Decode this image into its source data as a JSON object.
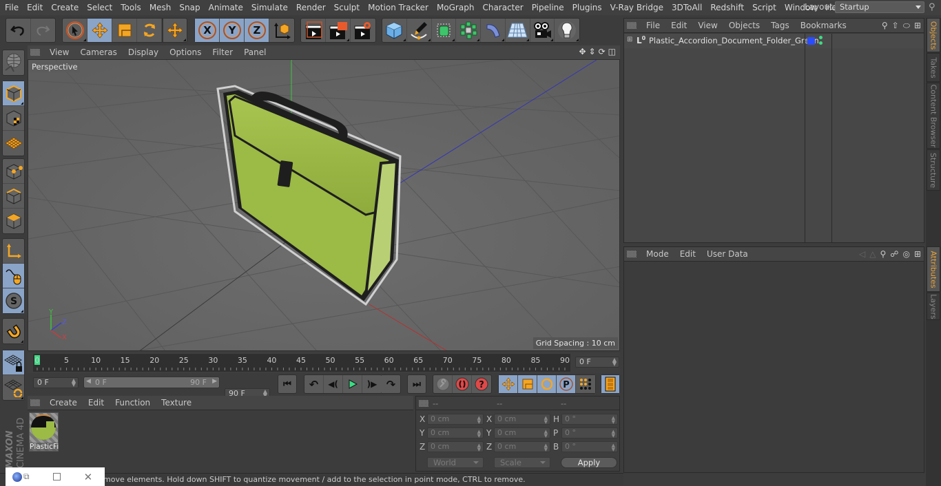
{
  "menubar": {
    "items": [
      "File",
      "Edit",
      "Create",
      "Select",
      "Tools",
      "Mesh",
      "Snap",
      "Animate",
      "Simulate",
      "Render",
      "Sculpt",
      "Motion Tracker",
      "MoGraph",
      "Character",
      "Pipeline",
      "Plugins",
      "V-Ray Bridge",
      "3DToAll",
      "Redshift",
      "Script",
      "Window",
      "Help"
    ],
    "layout_label": "Layout:",
    "layout_value": "Startup"
  },
  "toolbar": {
    "undo": "undo-icon",
    "redo": "redo-icon",
    "tools": [
      "select",
      "move",
      "scale",
      "rotate",
      "last-tool"
    ],
    "axes": [
      "X",
      "Y",
      "Z"
    ],
    "world_coords": "coordinate-system-icon",
    "render": [
      "render-view",
      "render-picture-viewer",
      "render-settings"
    ],
    "create": [
      "cube",
      "pen",
      "subdivision",
      "cloner",
      "deformer",
      "floor",
      "camera",
      "light"
    ]
  },
  "viewport": {
    "menu": [
      "View",
      "Cameras",
      "Display",
      "Options",
      "Filter",
      "Panel"
    ],
    "camera_label": "Perspective",
    "grid_spacing": "Grid Spacing : 10 cm",
    "object_color": "#9cba46",
    "axis_labels": [
      "Y",
      "Z",
      "X"
    ]
  },
  "timeline": {
    "ticks": [
      "0",
      "5",
      "10",
      "15",
      "20",
      "25",
      "30",
      "35",
      "40",
      "45",
      "50",
      "55",
      "60",
      "65",
      "70",
      "75",
      "80",
      "85",
      "90"
    ],
    "current_frame": "0 F",
    "start_frame": "0 F",
    "range_start": "0 F",
    "range_end": "90 F",
    "end_frame": "90 F",
    "playhead_color": "#3ddc84"
  },
  "material_manager": {
    "menu": [
      "Create",
      "Edit",
      "Function",
      "Texture"
    ],
    "materials": [
      {
        "name": "PlasticFi"
      }
    ]
  },
  "coordinates": {
    "headers": [
      "--",
      "--",
      "--"
    ],
    "position": {
      "X": "0 cm",
      "Y": "0 cm",
      "Z": "0 cm"
    },
    "size": {
      "X": "0 cm",
      "Y": "0 cm",
      "Z": "0 cm"
    },
    "rotation": {
      "H": "0 °",
      "P": "0 °",
      "B": "0 °"
    },
    "mode_dropdown": "World",
    "size_dropdown": "Scale",
    "apply_label": "Apply"
  },
  "status": {
    "text": "move elements. Hold down SHIFT to quantize movement / add to the selection in point mode, CTRL to remove."
  },
  "objects_panel": {
    "menu": [
      "File",
      "Edit",
      "View",
      "Objects",
      "Tags",
      "Bookmarks"
    ],
    "objects": [
      {
        "name": "Plastic_Accordion_Document_Folder_Green",
        "layer_color": "#2a4cff"
      }
    ]
  },
  "attributes_panel": {
    "menu": [
      "Mode",
      "Edit",
      "User Data"
    ]
  },
  "right_tabs": {
    "top": [
      "Objects",
      "Takes",
      "Content Browser",
      "Structure"
    ],
    "bottom": [
      "Attributes",
      "Layers"
    ]
  },
  "brand": {
    "maxon": "MAXON",
    "product": "CINEMA 4D"
  }
}
